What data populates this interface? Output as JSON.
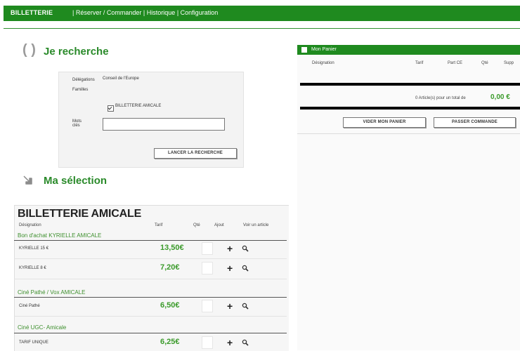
{
  "nav": {
    "brand": "BILLETTERIE",
    "links": [
      "Réserver / Commander",
      "Historique",
      "Configuration"
    ],
    "separator": "|"
  },
  "search": {
    "title": "Je recherche",
    "delegations_label": "Délégations",
    "delegations_value": "Conseil de l'Europe",
    "familles_label": "Familles",
    "famille_option": "BILLETTERIE AMICALE",
    "famille_checked": true,
    "mots_label_1": "Mots",
    "mots_label_2": "clés",
    "mots_value": "",
    "button": "LANCER LA RECHERCHE"
  },
  "selection": {
    "title": "Ma sélection",
    "panel_title": "BILLETTERIE AMICALE",
    "columns": [
      "Désignation",
      "Tarif",
      "Qté",
      "Ajout",
      "Voir un article"
    ],
    "groups": [
      {
        "name": "Bon d'achat KYRIELLE AMICALE",
        "rows": [
          {
            "designation": "KYRIELLE 15 €",
            "price": "13,50€"
          },
          {
            "designation": "KYRIELLE 8 €",
            "price": "7,20€"
          }
        ]
      },
      {
        "name": "Ciné Pathé / Vox AMICALE",
        "rows": [
          {
            "designation": "Ciné Pathé",
            "price": "6,50€"
          }
        ]
      },
      {
        "name": "Ciné UGC- Amicale",
        "rows": [
          {
            "designation": "TARIF UNIQUE",
            "price": "6,25€"
          }
        ]
      }
    ]
  },
  "cart": {
    "title": "Mon Panier",
    "columns": [
      "Désignation",
      "Tarif",
      "Part CE",
      "Qté",
      "Supp"
    ],
    "summary": "0 Article(s) pour un total de",
    "total": "0,00 €",
    "empty_button": "VIDER MON PANIER",
    "order_button": "PASSER COMMANDE"
  },
  "colors": {
    "accent": "#1f8a1f",
    "price": "#3a9a2a"
  },
  "icons": [
    "paren-icon",
    "arrow-down-right-icon",
    "plus-icon",
    "magnifier-icon"
  ]
}
